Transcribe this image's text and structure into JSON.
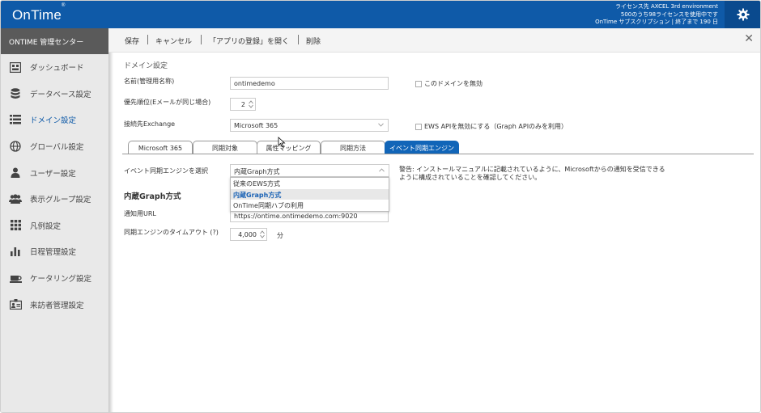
{
  "app": {
    "logo": "OnTime",
    "logo_mark": "®",
    "license_lines": [
      "ライセンス先 AXCEL 3rd environment",
      "500のうち98ライセンスを使用中です",
      "OnTime サブスクリプション | 終了まで 190 日"
    ]
  },
  "sidebar": {
    "header": "ONTIME 管理センター",
    "items": [
      {
        "label": "ダッシュボード",
        "icon": "dashboard-icon"
      },
      {
        "label": "データベース設定",
        "icon": "database-icon"
      },
      {
        "label": "ドメイン設定",
        "icon": "domain-icon",
        "active": true
      },
      {
        "label": "グローバル設定",
        "icon": "globe-icon"
      },
      {
        "label": "ユーザー設定",
        "icon": "user-icon"
      },
      {
        "label": "表示グループ設定",
        "icon": "group-icon"
      },
      {
        "label": "凡例設定",
        "icon": "legend-icon"
      },
      {
        "label": "日程管理設定",
        "icon": "chart-icon"
      },
      {
        "label": "ケータリング設定",
        "icon": "catering-icon"
      },
      {
        "label": "来訪者管理設定",
        "icon": "visitor-icon"
      }
    ]
  },
  "toolbar": {
    "save": "保存",
    "cancel": "キャンセル",
    "open_app_reg": "「アプリの登録」を開く",
    "delete": "削除",
    "close": "✕"
  },
  "form": {
    "section_title": "ドメイン設定",
    "name_label": "名前(管理用名称)",
    "name_value": "ontimedemo",
    "disable_domain_label": "このドメインを無効",
    "priority_label": "優先順位(Eメールが同じ場合)",
    "priority_value": "2",
    "exchange_label": "接続先Exchange",
    "exchange_value": "Microsoft 365",
    "ews_disable_label": "EWS APIを無効にする（Graph APIのみを利用）"
  },
  "tabs": [
    {
      "label": "Microsoft 365"
    },
    {
      "label": "同期対象"
    },
    {
      "label": "属性マッピング"
    },
    {
      "label": "同期方法"
    },
    {
      "label": "イベント同期エンジン",
      "active": true
    }
  ],
  "engine": {
    "select_label": "イベント同期エンジンを選択",
    "select_value": "内蔵Graph方式",
    "options": [
      "従来のEWS方式",
      "内蔵Graph方式",
      "OnTime同期ハブの利用"
    ],
    "selected_option": "内蔵Graph方式",
    "warning": "警告: インストールマニュアルに記載されているように、Microsoftからの通知を受信できるように構成されていることを確認してください。",
    "graph_title": "内蔵Graph方式",
    "notify_url_label": "通知用URL",
    "notify_url_value": "https://ontime.ontimedemo.com:9020",
    "timeout_label": "同期エンジンのタイムアウト (?)",
    "timeout_value": "4,000",
    "timeout_unit": "分"
  },
  "colors": {
    "topbar": "#0f5aa8",
    "active_tab": "#1165b8",
    "sidebar_header": "#5a5a5a",
    "sidebar_bg": "#e9e9e9"
  }
}
